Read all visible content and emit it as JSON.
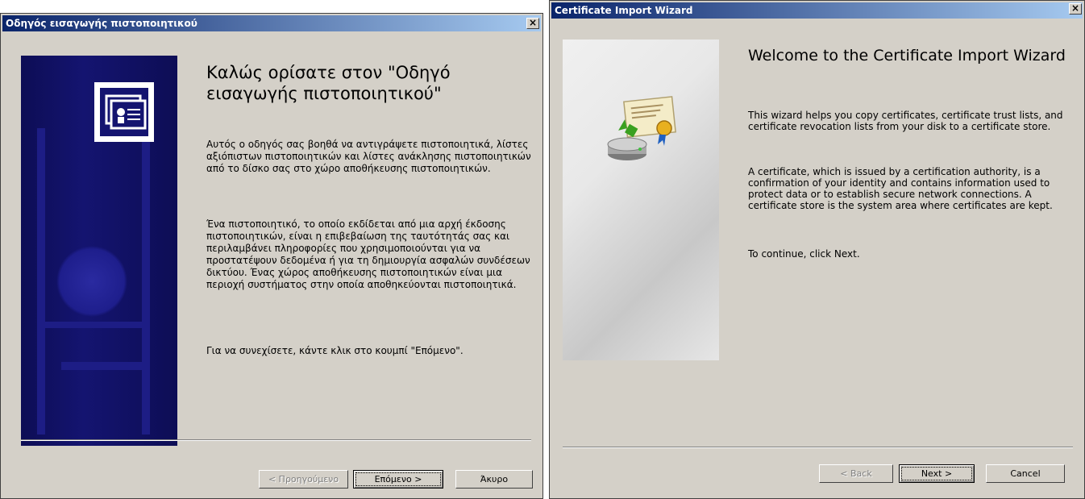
{
  "left_dialog": {
    "title": "Οδηγός εισαγωγής πιστοποιητικού",
    "close_glyph": "×",
    "heading": "Καλώς ορίσατε στον \"Οδηγό εισαγωγής πιστοποιητικού\"",
    "paragraph1": "Αυτός ο οδηγός σας βοηθά να αντιγράψετε πιστοποιητικά, λίστες αξιόπιστων πιστοποιητικών και λίστες ανάκλησης πιστοποιητικών από το δίσκο σας στο χώρο αποθήκευσης πιστοποιητικών.",
    "paragraph2": "Ένα πιστοποιητικό, το οποίο εκδίδεται από μια αρχή έκδοσης πιστοποιητικών, είναι η επιβεβαίωση της ταυτότητάς σας και περιλαμβάνει πληροφορίες που χρησιμοποιούνται για να προστατέψουν δεδομένα ή για τη δημιουργία ασφαλών συνδέσεων δικτύου. Ένας χώρος αποθήκευσης πιστοποιητικών είναι μια περιοχή συστήματος στην οποία αποθηκεύονται πιστοποιητικά.",
    "paragraph3": "Για να συνεχίσετε, κάντε κλικ στο κουμπί \"Επόμενο\".",
    "back_label": "< Προηγούμενο",
    "next_label": "Επόμενο >",
    "cancel_label": "Άκυρο"
  },
  "right_dialog": {
    "title": "Certificate Import Wizard",
    "close_glyph": "×",
    "heading": "Welcome to the Certificate Import Wizard",
    "paragraph1": "This wizard helps you copy certificates, certificate trust lists, and certificate revocation lists from your disk to a certificate store.",
    "paragraph2": "A certificate, which is issued by a certification authority, is a confirmation of your identity and contains information used to protect data or to establish secure network connections. A certificate store is the system area where certificates are kept.",
    "paragraph3": "To continue, click Next.",
    "back_label": "< Back",
    "next_label": "Next >",
    "cancel_label": "Cancel"
  },
  "icons": {
    "left_banner_icon": "certificate-card-icon",
    "right_banner_icon": "certificate-import-icon"
  },
  "colors": {
    "titlebar_start": "#0a246a",
    "titlebar_end": "#a6caf0",
    "dialog_face": "#d4d0c8",
    "left_banner": "#141470"
  }
}
